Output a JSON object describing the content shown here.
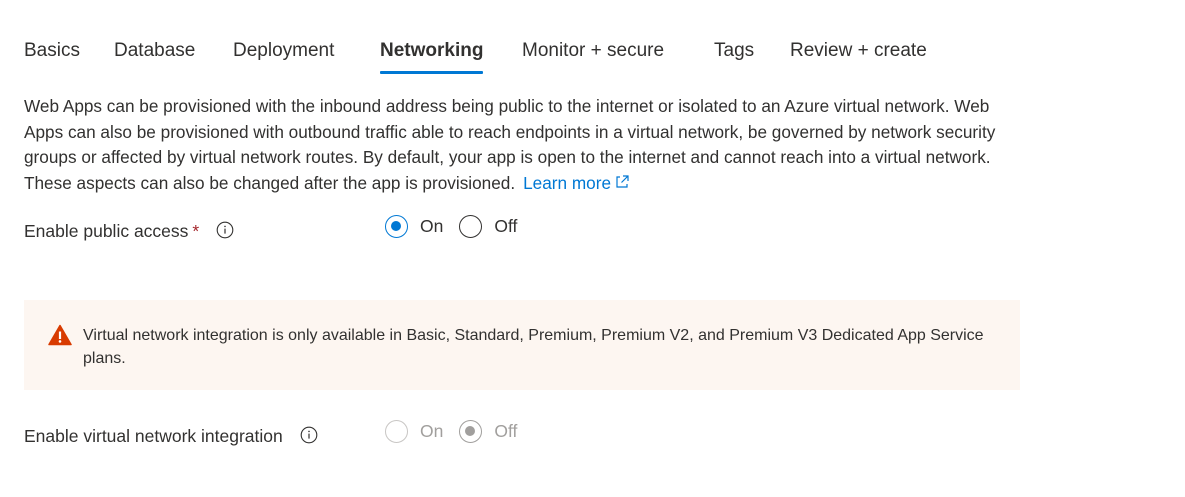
{
  "tabs": [
    {
      "label": "Basics"
    },
    {
      "label": "Database"
    },
    {
      "label": "Deployment"
    },
    {
      "label": "Networking",
      "active": true
    },
    {
      "label": "Monitor + secure"
    },
    {
      "label": "Tags"
    },
    {
      "label": "Review + create"
    }
  ],
  "description": {
    "text": "Web Apps can be provisioned with the inbound address being public to the internet or isolated to an Azure virtual network. Web Apps can also be provisioned with outbound traffic able to reach endpoints in a virtual network, be governed by network security groups or affected by virtual network routes. By default, your app is open to the internet and cannot reach into a virtual network. These aspects can also be changed after the app is provisioned.",
    "link_label": "Learn more",
    "link_icon": "external-link-icon"
  },
  "public_access": {
    "label": "Enable public access",
    "required_mark": "*",
    "info_icon": "info-icon",
    "options": [
      {
        "label": "On",
        "checked": true
      },
      {
        "label": "Off",
        "checked": false
      }
    ]
  },
  "warning": {
    "icon": "warning-icon",
    "text": "Virtual network integration is only available in Basic, Standard, Premium, Premium V2, and Premium V3 Dedicated App Service plans.",
    "background": "#fdf6f1",
    "icon_color": "#d83b01"
  },
  "vnet_integration": {
    "label": "Enable virtual network integration",
    "info_icon": "info-icon",
    "disabled": true,
    "options": [
      {
        "label": "On",
        "checked": false
      },
      {
        "label": "Off",
        "checked": true
      }
    ]
  },
  "colors": {
    "accent": "#0078d4",
    "required": "#a4262c",
    "disabled_text": "#a19f9d"
  }
}
